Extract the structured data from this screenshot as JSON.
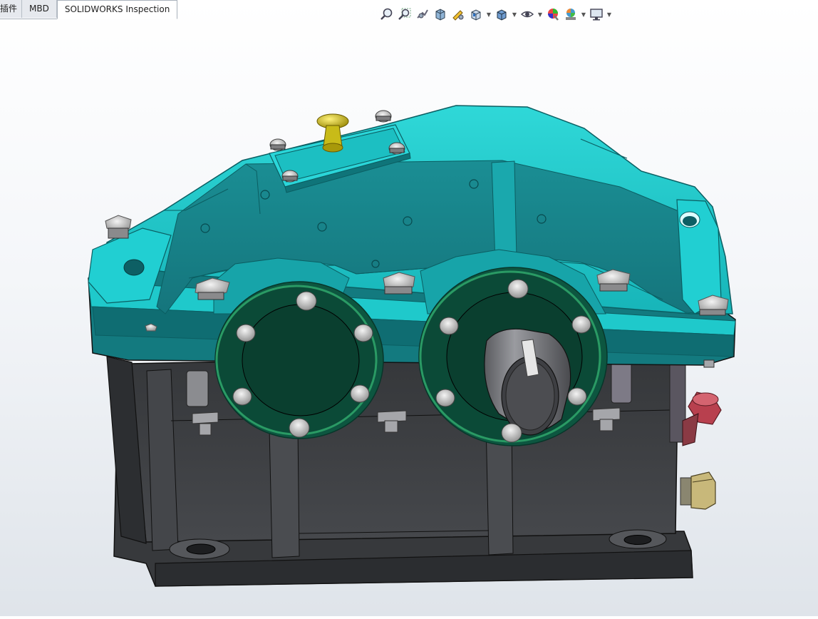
{
  "tabs": [
    {
      "label": "插件"
    },
    {
      "label": "MBD"
    },
    {
      "label": "SOLIDWORKS Inspection"
    }
  ],
  "toolbar": {
    "buttons": [
      {
        "icon": "zoom-to-fit-icon"
      },
      {
        "icon": "zoom-to-area-icon"
      },
      {
        "icon": "previous-view-icon"
      },
      {
        "icon": "section-view-icon"
      },
      {
        "icon": "dynamic-annotation-icon"
      },
      {
        "icon": "view-orientation-icon"
      },
      {
        "icon": "display-style-icon"
      },
      {
        "icon": "hide-show-items-icon"
      },
      {
        "icon": "edit-appearance-icon"
      },
      {
        "icon": "apply-scene-icon"
      },
      {
        "icon": "view-settings-icon"
      }
    ]
  },
  "model": {
    "name": "gear-reducer",
    "colors": {
      "housing": "#1ec8c8",
      "housing_dark": "#178f94",
      "base": "#3d3f42",
      "base_dark": "#2a2c2e",
      "bearing_cap": "#0b4a37",
      "cap_ring": "#1f8a55",
      "shaft": "#6e6f73",
      "dipstick": "#c8bb18",
      "drain_plug": "#b8404e",
      "plug_nut": "#c8b87a"
    }
  }
}
